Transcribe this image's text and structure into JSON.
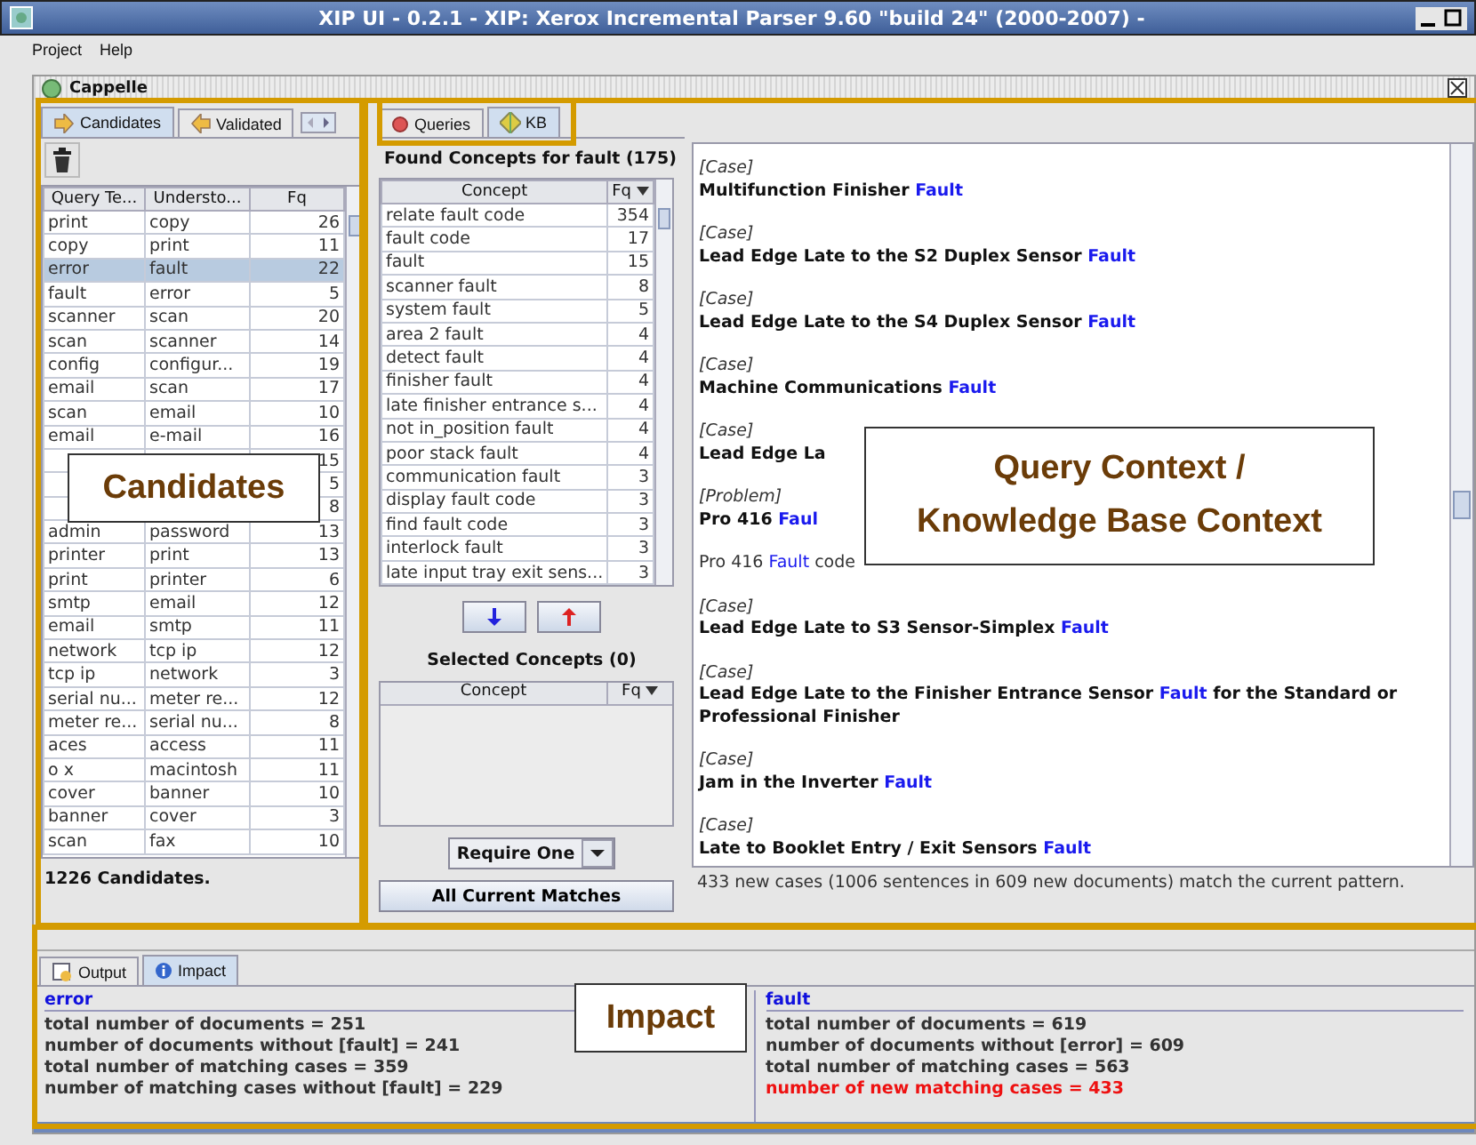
{
  "window": {
    "title": "XIP UI - 0.2.1 - XIP: Xerox Incremental Parser 9.60 \"build 24\" (2000-2007)  -"
  },
  "menu": [
    "Project",
    "Help"
  ],
  "frame": {
    "title": "Cappelle"
  },
  "left_tabs": [
    {
      "label": "Candidates",
      "selected": true
    },
    {
      "label": "Validated",
      "selected": false
    }
  ],
  "candidates": {
    "columns": [
      "Query Te...",
      "Understo...",
      "Fq"
    ],
    "rows": [
      {
        "query": "print",
        "understood": "copy",
        "fq": "26",
        "selected": false
      },
      {
        "query": "copy",
        "understood": "print",
        "fq": "11",
        "selected": false
      },
      {
        "query": "error",
        "understood": "fault",
        "fq": "22",
        "selected": true
      },
      {
        "query": "fault",
        "understood": "error",
        "fq": "5",
        "selected": false
      },
      {
        "query": "scanner",
        "understood": "scan",
        "fq": "20",
        "selected": false
      },
      {
        "query": "scan",
        "understood": "scanner",
        "fq": "14",
        "selected": false
      },
      {
        "query": "config",
        "understood": "configur...",
        "fq": "19",
        "selected": false
      },
      {
        "query": "email",
        "understood": "scan",
        "fq": "17",
        "selected": false
      },
      {
        "query": "scan",
        "understood": "email",
        "fq": "10",
        "selected": false
      },
      {
        "query": "email",
        "understood": "e-mail",
        "fq": "16",
        "selected": false
      },
      {
        "fq": "15",
        "selected": false
      },
      {
        "fq": "5",
        "selected": false
      },
      {
        "fq": "8",
        "selected": false
      },
      {
        "query": "admin",
        "understood": "password",
        "fq": "13",
        "selected": false
      },
      {
        "query": "printer",
        "understood": "print",
        "fq": "13",
        "selected": false
      },
      {
        "query": "print",
        "understood": "printer",
        "fq": "6",
        "selected": false
      },
      {
        "query": "smtp",
        "understood": "email",
        "fq": "12",
        "selected": false
      },
      {
        "query": "email",
        "understood": "smtp",
        "fq": "11",
        "selected": false
      },
      {
        "query": "network",
        "understood": "tcp ip",
        "fq": "12",
        "selected": false
      },
      {
        "query": "tcp ip",
        "understood": "network",
        "fq": "3",
        "selected": false
      },
      {
        "query": "serial nu...",
        "understood": "meter re...",
        "fq": "12",
        "selected": false
      },
      {
        "query": "meter re...",
        "understood": "serial nu...",
        "fq": "8",
        "selected": false
      },
      {
        "query": "aces",
        "understood": "access",
        "fq": "11",
        "selected": false
      },
      {
        "query": "o x",
        "understood": "macintosh",
        "fq": "11",
        "selected": false
      },
      {
        "query": "cover",
        "understood": "banner",
        "fq": "10",
        "selected": false
      },
      {
        "query": "banner",
        "understood": "cover",
        "fq": "3",
        "selected": false
      },
      {
        "query": "scan",
        "understood": "fax",
        "fq": "10",
        "selected": false
      }
    ],
    "status": "1226 Candidates."
  },
  "mid_tabs": [
    {
      "label": "Queries",
      "selected": false
    },
    {
      "label": "KB",
      "selected": true
    }
  ],
  "found": {
    "title": "Found Concepts for fault (175)",
    "columns": [
      "Concept",
      "Fq"
    ],
    "rows": [
      {
        "concept": "relate fault code",
        "fq": "354"
      },
      {
        "concept": "fault code",
        "fq": "17"
      },
      {
        "concept": "fault",
        "fq": "15"
      },
      {
        "concept": "scanner fault",
        "fq": "8"
      },
      {
        "concept": "system fault",
        "fq": "5"
      },
      {
        "concept": "area 2 fault",
        "fq": "4"
      },
      {
        "concept": "detect fault",
        "fq": "4"
      },
      {
        "concept": "finisher fault",
        "fq": "4"
      },
      {
        "concept": "late finisher entrance s...",
        "fq": "4"
      },
      {
        "concept": "not in_position fault",
        "fq": "4"
      },
      {
        "concept": "poor stack fault",
        "fq": "4"
      },
      {
        "concept": "communication fault",
        "fq": "3"
      },
      {
        "concept": "display fault code",
        "fq": "3"
      },
      {
        "concept": "find fault code",
        "fq": "3"
      },
      {
        "concept": "interlock fault",
        "fq": "3"
      },
      {
        "concept": "late input tray exit sens...",
        "fq": "3"
      }
    ]
  },
  "selected": {
    "title": "Selected Concepts (0)",
    "columns": [
      "Concept",
      "Fq"
    ]
  },
  "match_mode": {
    "value": "Require One"
  },
  "all_matches_button": "All Current Matches",
  "context": {
    "entries": [
      {
        "label": "[Case]",
        "kind": "title",
        "parts": [
          {
            "text": "Multifunction Finisher "
          },
          {
            "text": "Fault",
            "kind": "match"
          }
        ]
      },
      {
        "label": "[Case]",
        "kind": "title",
        "parts": [
          {
            "text": "Lead Edge Late to the S2 Duplex Sensor "
          },
          {
            "text": "Fault",
            "kind": "match"
          }
        ]
      },
      {
        "label": "[Case]",
        "kind": "title",
        "parts": [
          {
            "text": "Lead Edge Late to the S4 Duplex Sensor "
          },
          {
            "text": "Fault",
            "kind": "match"
          }
        ]
      },
      {
        "label": "[Case]",
        "kind": "title",
        "parts": [
          {
            "text": "Machine Communications "
          },
          {
            "text": "Fault",
            "kind": "match"
          }
        ]
      },
      {
        "label": "[Case]",
        "kind": "title",
        "parts": [
          {
            "text": "Lead Edge La"
          }
        ]
      },
      {
        "label": "[Problem]",
        "kind": "title",
        "parts": [
          {
            "text": "Pro 416 "
          },
          {
            "text": "Faul",
            "kind": "match"
          }
        ]
      },
      {
        "kind": "plain",
        "parts": [
          {
            "text": "Pro 416 "
          },
          {
            "text": "Fault",
            "kind": "match"
          },
          {
            "text": " code"
          }
        ]
      },
      {
        "label": "[Case]",
        "kind": "title",
        "parts": [
          {
            "text": "Lead Edge Late to S3 Sensor-Simplex "
          },
          {
            "text": "Fault",
            "kind": "match"
          }
        ]
      },
      {
        "label": "[Case]",
        "kind": "title",
        "parts": [
          {
            "text": "Lead Edge Late to the Finisher Entrance Sensor "
          },
          {
            "text": "Fault",
            "kind": "match"
          },
          {
            "text": " for the Standard or Professional Finisher"
          }
        ]
      },
      {
        "label": "[Case]",
        "kind": "title",
        "parts": [
          {
            "text": "Jam in the Inverter "
          },
          {
            "text": "Fault",
            "kind": "match"
          }
        ]
      },
      {
        "label": "[Case]",
        "kind": "title",
        "parts": [
          {
            "text": "Late to Booklet Entry / Exit Sensors "
          },
          {
            "text": "Fault",
            "kind": "match"
          }
        ]
      }
    ],
    "status": "433 new cases (1006 sentences in 609 new documents) match the current pattern."
  },
  "bottom_tabs": [
    {
      "label": "Output",
      "selected": false
    },
    {
      "label": "Impact",
      "selected": true
    }
  ],
  "impact": [
    {
      "term": "error",
      "lines": [
        {
          "text": "total number of documents = 251",
          "kind": "normal"
        },
        {
          "text": "number of documents without [fault] = 241",
          "kind": "normal"
        },
        {
          "text": "total number of matching cases = 359",
          "kind": "normal"
        },
        {
          "text": "number of matching cases without [fault] = 229",
          "kind": "normal"
        }
      ]
    },
    {
      "term": "fault",
      "lines": [
        {
          "text": "total number of documents = 619",
          "kind": "normal"
        },
        {
          "text": "number of documents without [error] = 609",
          "kind": "normal"
        },
        {
          "text": "total number of matching cases = 563",
          "kind": "normal"
        },
        {
          "text": "number of new matching cases = 433",
          "kind": "alert"
        }
      ]
    }
  ],
  "callouts": [
    {
      "lines": [
        "Candidates"
      ]
    },
    {
      "lines": [
        "Query Context /",
        "Knowledge Base Context"
      ]
    },
    {
      "lines": [
        "Impact"
      ]
    }
  ]
}
